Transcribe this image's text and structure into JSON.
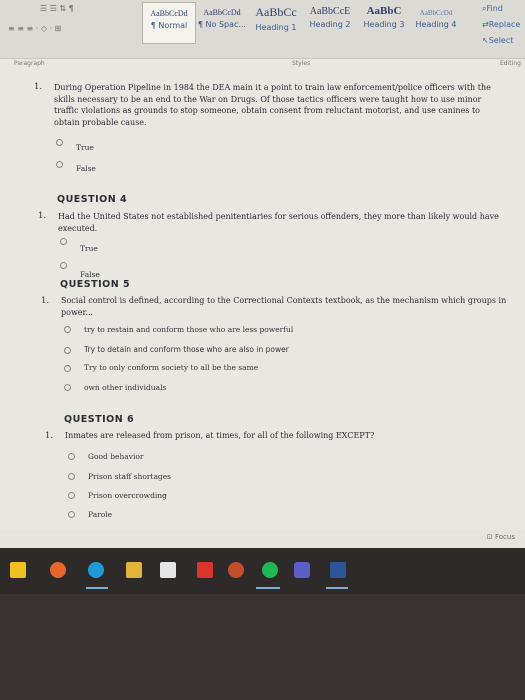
{
  "ribbon": {
    "styles": [
      {
        "sample": "AaBbCcDd",
        "name": "¶ Normal",
        "size": 8
      },
      {
        "sample": "AaBbCcDd",
        "name": "¶ No Spac...",
        "size": 8
      },
      {
        "sample": "AaBbCc",
        "name": "Heading 1",
        "size": 12
      },
      {
        "sample": "AaBbCcE",
        "name": "Heading 2",
        "size": 11
      },
      {
        "sample": "AaBbC",
        "name": "Heading 3",
        "size": 12
      },
      {
        "sample": "AaBbCcDd",
        "name": "Heading 4",
        "size": 7
      }
    ],
    "find": "Find",
    "replace": "Replace",
    "select": "Select",
    "paragraph": "Paragraph",
    "styles_label": "Styles",
    "editing": "Editing"
  },
  "doc": {
    "q3": {
      "num": "1.",
      "text": "During Operation Pipeline in 1984 the DEA main it a point to train law enforcement/police officers with the skills necessary to be an end to the War on Drugs. Of those tactics officers were taught how to use minor traffic violations as grounds to stop someone, obtain consent from reluctant motorist, and use canines to obtain probable cause.",
      "options": [
        "True",
        "False"
      ]
    },
    "q4": {
      "heading": "QUESTION 4",
      "num": "1.",
      "text": "Had the United States not established penitentiaries for serious offenders, they more than likely would have executed.",
      "options": [
        "True",
        "False"
      ]
    },
    "q5": {
      "heading": "QUESTION 5",
      "num": "1.",
      "text": "Social control is defined, according to the Correctional Contexts textbook, as the mechanism which groups in power...",
      "options": [
        "try to restain and conform those who are less powerful",
        "Try to detain and conform those who are also in power",
        "Try to only conform society to all be the same",
        "own other individuals"
      ]
    },
    "q6": {
      "heading": "QUESTION 6",
      "num": "1.",
      "text": "Inmates are released from prison, at times, for all of the following EXCEPT?",
      "options": [
        "Good behavior",
        "Prison staff shortages",
        "Prison overcrowding",
        "Parole"
      ]
    }
  },
  "status": {
    "focus": "Focus"
  },
  "taskbar": {
    "icons": [
      "taskbar-store-icon",
      "taskbar-firefox-icon",
      "taskbar-edge-icon",
      "taskbar-files-icon",
      "taskbar-office-icon",
      "taskbar-app-icon",
      "taskbar-spotify-icon",
      "taskbar-teams-icon",
      "taskbar-word-icon"
    ]
  }
}
